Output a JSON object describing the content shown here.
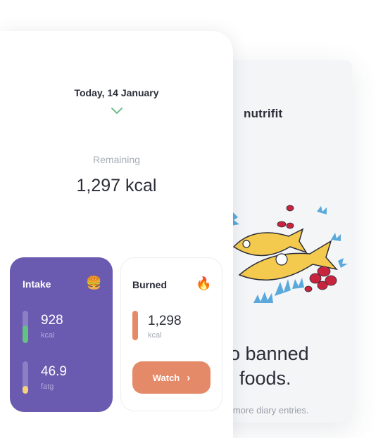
{
  "brand": {
    "name": "nutrifit"
  },
  "promo": {
    "headline_line1": "o banned",
    "headline_line2": "foods.",
    "subtext": "e more diary entries."
  },
  "header": {
    "date": "Today, 14 January"
  },
  "summary": {
    "remaining_label": "Remaining",
    "remaining_value": "1,297 kcal"
  },
  "intake": {
    "title": "Intake",
    "emoji": "🍔",
    "metrics": [
      {
        "value": "928",
        "unit": "kcal",
        "fill_fraction": 0.55
      },
      {
        "value": "46.9",
        "unit": "fatg",
        "fill_fraction": 0.25
      }
    ]
  },
  "burned": {
    "title": "Burned",
    "emoji": "🔥",
    "metric": {
      "value": "1,298",
      "unit": "kcal",
      "fill_fraction": 1.0
    },
    "button_label": "Watch",
    "button_arrow": "›"
  },
  "colors": {
    "intake_bg": "#6a5ab0",
    "bar_green": "#63c27f",
    "bar_yellow": "#f4d27a",
    "bar_orange": "#e58a69",
    "accent_green": "#6fbf8c"
  }
}
